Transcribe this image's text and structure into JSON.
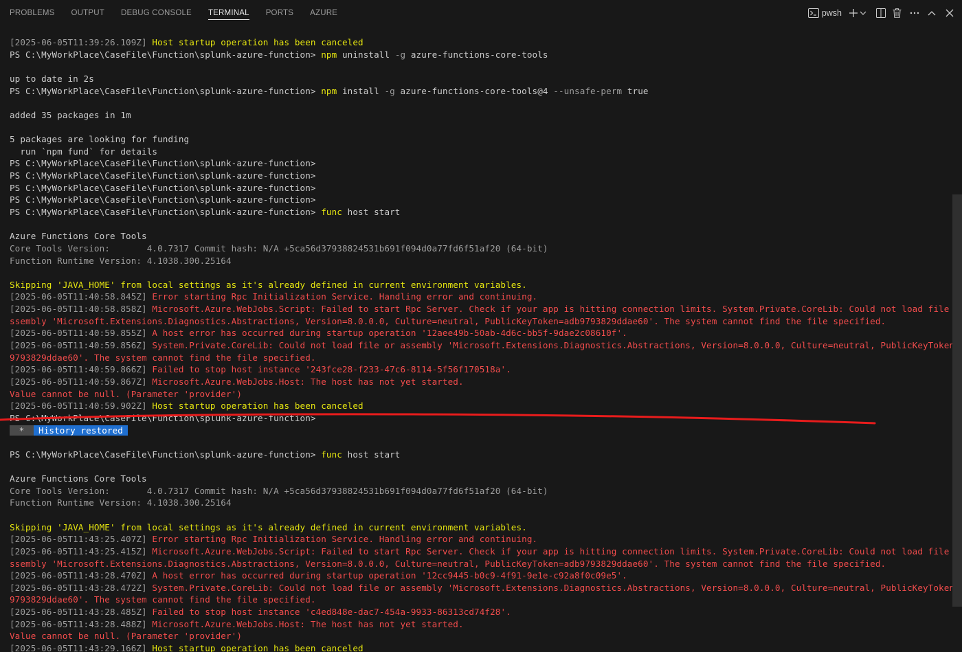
{
  "panel": {
    "tabs": [
      "PROBLEMS",
      "OUTPUT",
      "DEBUG CONSOLE",
      "TERMINAL",
      "PORTS",
      "AZURE"
    ],
    "active_tab": "TERMINAL",
    "shell": "pwsh"
  },
  "colors": {
    "background": "#181818",
    "timestamp": "#9d9d9d",
    "warning": "#e5e510",
    "error": "#f14c4c",
    "badge": "#1f6fd0",
    "annotation": "#e81c1c"
  },
  "terminal": {
    "lines": [
      [
        {
          "c": "ts",
          "t": "[2025-06-05T11:39:26.109Z] "
        },
        {
          "c": "yl",
          "t": "Host startup operation has been canceled"
        }
      ],
      [
        {
          "c": "",
          "t": "PS C:\\MyWorkPlace\\CaseFile\\Function\\splunk-azure-function> "
        },
        {
          "c": "cmd",
          "t": "npm"
        },
        {
          "c": "arg",
          "t": " uninstall "
        },
        {
          "c": "flag",
          "t": "-g"
        },
        {
          "c": "arg",
          "t": " azure-functions-core-tools"
        }
      ],
      [],
      [
        {
          "c": "",
          "t": "up to date in 2s"
        }
      ],
      [
        {
          "c": "",
          "t": "PS C:\\MyWorkPlace\\CaseFile\\Function\\splunk-azure-function> "
        },
        {
          "c": "cmd",
          "t": "npm"
        },
        {
          "c": "arg",
          "t": " install "
        },
        {
          "c": "flag",
          "t": "-g"
        },
        {
          "c": "arg",
          "t": " azure-functions-core-tools@4 "
        },
        {
          "c": "flag",
          "t": "--unsafe-perm"
        },
        {
          "c": "arg",
          "t": " true"
        }
      ],
      [],
      [
        {
          "c": "",
          "t": "added 35 packages in 1m"
        }
      ],
      [],
      [
        {
          "c": "",
          "t": "5 packages are looking for funding"
        }
      ],
      [
        {
          "c": "",
          "t": "  run `npm fund` for details"
        }
      ],
      [
        {
          "c": "",
          "t": "PS C:\\MyWorkPlace\\CaseFile\\Function\\splunk-azure-function>"
        }
      ],
      [
        {
          "c": "",
          "t": "PS C:\\MyWorkPlace\\CaseFile\\Function\\splunk-azure-function>"
        }
      ],
      [
        {
          "c": "",
          "t": "PS C:\\MyWorkPlace\\CaseFile\\Function\\splunk-azure-function>"
        }
      ],
      [
        {
          "c": "",
          "t": "PS C:\\MyWorkPlace\\CaseFile\\Function\\splunk-azure-function>"
        }
      ],
      [
        {
          "c": "",
          "t": "PS C:\\MyWorkPlace\\CaseFile\\Function\\splunk-azure-function> "
        },
        {
          "c": "cmd",
          "t": "func"
        },
        {
          "c": "arg",
          "t": " host start"
        }
      ],
      [],
      [
        {
          "c": "",
          "t": "Azure Functions Core Tools"
        }
      ],
      [
        {
          "c": "gray",
          "t": "Core Tools Version:       4.0.7317 Commit hash: N/A +5ca56d37938824531b691f094d0a77fd6f51af20 (64-bit)"
        }
      ],
      [
        {
          "c": "gray",
          "t": "Function Runtime Version: 4.1038.300.25164"
        }
      ],
      [],
      [
        {
          "c": "yl",
          "t": "Skipping 'JAVA_HOME' from local settings as it's already defined in current environment variables."
        }
      ],
      [
        {
          "c": "ts",
          "t": "[2025-06-05T11:40:58.845Z] "
        },
        {
          "c": "rd",
          "t": "Error starting Rpc Initialization Service. Handling error and continuing."
        }
      ],
      [
        {
          "c": "ts",
          "t": "[2025-06-05T11:40:58.858Z] "
        },
        {
          "c": "rd",
          "t": "Microsoft.Azure.WebJobs.Script: Failed to start Rpc Server. Check if your app is hitting connection limits. System.Private.CoreLib: Could not load file or a"
        }
      ],
      [
        {
          "c": "rd",
          "t": "ssembly 'Microsoft.Extensions.Diagnostics.Abstractions, Version=8.0.0.0, Culture=neutral, PublicKeyToken=adb9793829ddae60'. The system cannot find the file specified."
        }
      ],
      [
        {
          "c": "ts",
          "t": "[2025-06-05T11:40:59.855Z] "
        },
        {
          "c": "rd",
          "t": "A host error has occurred during startup operation '12aee49b-50ab-4d6c-bb5f-9dae2c08610f'."
        }
      ],
      [
        {
          "c": "ts",
          "t": "[2025-06-05T11:40:59.856Z] "
        },
        {
          "c": "rd",
          "t": "System.Private.CoreLib: Could not load file or assembly 'Microsoft.Extensions.Diagnostics.Abstractions, Version=8.0.0.0, Culture=neutral, PublicKeyToken=adb"
        }
      ],
      [
        {
          "c": "rd",
          "t": "9793829ddae60'. The system cannot find the file specified."
        }
      ],
      [
        {
          "c": "ts",
          "t": "[2025-06-05T11:40:59.866Z] "
        },
        {
          "c": "rd",
          "t": "Failed to stop host instance '243fce28-f233-47c6-8114-5f56f170518a'."
        }
      ],
      [
        {
          "c": "ts",
          "t": "[2025-06-05T11:40:59.867Z] "
        },
        {
          "c": "rd",
          "t": "Microsoft.Azure.WebJobs.Host: The host has not yet started."
        }
      ],
      [
        {
          "c": "rd",
          "t": "Value cannot be null. (Parameter 'provider')"
        }
      ],
      [
        {
          "c": "ts",
          "t": "[2025-06-05T11:40:59.902Z] "
        },
        {
          "c": "yl",
          "t": "Host startup operation has been canceled"
        }
      ],
      [
        {
          "c": "",
          "t": "PS C:\\MyWorkPlace\\CaseFile\\Function\\splunk-azure-function>"
        }
      ],
      [
        {
          "c": "badge-star",
          "t": " * "
        },
        {
          "c": "badge",
          "t": "History restored"
        }
      ],
      [],
      [
        {
          "c": "",
          "t": "PS C:\\MyWorkPlace\\CaseFile\\Function\\splunk-azure-function> "
        },
        {
          "c": "cmd",
          "t": "func"
        },
        {
          "c": "arg",
          "t": " host start"
        }
      ],
      [],
      [
        {
          "c": "",
          "t": "Azure Functions Core Tools"
        }
      ],
      [
        {
          "c": "gray",
          "t": "Core Tools Version:       4.0.7317 Commit hash: N/A +5ca56d37938824531b691f094d0a77fd6f51af20 (64-bit)"
        }
      ],
      [
        {
          "c": "gray",
          "t": "Function Runtime Version: 4.1038.300.25164"
        }
      ],
      [],
      [
        {
          "c": "yl",
          "t": "Skipping 'JAVA_HOME' from local settings as it's already defined in current environment variables."
        }
      ],
      [
        {
          "c": "ts",
          "t": "[2025-06-05T11:43:25.407Z] "
        },
        {
          "c": "rd",
          "t": "Error starting Rpc Initialization Service. Handling error and continuing."
        }
      ],
      [
        {
          "c": "ts",
          "t": "[2025-06-05T11:43:25.415Z] "
        },
        {
          "c": "rd",
          "t": "Microsoft.Azure.WebJobs.Script: Failed to start Rpc Server. Check if your app is hitting connection limits. System.Private.CoreLib: Could not load file or a"
        }
      ],
      [
        {
          "c": "rd",
          "t": "ssembly 'Microsoft.Extensions.Diagnostics.Abstractions, Version=8.0.0.0, Culture=neutral, PublicKeyToken=adb9793829ddae60'. The system cannot find the file specified."
        }
      ],
      [
        {
          "c": "ts",
          "t": "[2025-06-05T11:43:28.470Z] "
        },
        {
          "c": "rd",
          "t": "A host error has occurred during startup operation '12cc9445-b0c9-4f91-9e1e-c92a8f0c09e5'."
        }
      ],
      [
        {
          "c": "ts",
          "t": "[2025-06-05T11:43:28.472Z] "
        },
        {
          "c": "rd",
          "t": "System.Private.CoreLib: Could not load file or assembly 'Microsoft.Extensions.Diagnostics.Abstractions, Version=8.0.0.0, Culture=neutral, PublicKeyToken=adb"
        }
      ],
      [
        {
          "c": "rd",
          "t": "9793829ddae60'. The system cannot find the file specified."
        }
      ],
      [
        {
          "c": "ts",
          "t": "[2025-06-05T11:43:28.485Z] "
        },
        {
          "c": "rd",
          "t": "Failed to stop host instance 'c4ed848e-dac7-454a-9933-86313cd74f28'."
        }
      ],
      [
        {
          "c": "ts",
          "t": "[2025-06-05T11:43:28.488Z] "
        },
        {
          "c": "rd",
          "t": "Microsoft.Azure.WebJobs.Host: The host has not yet started."
        }
      ],
      [
        {
          "c": "rd",
          "t": "Value cannot be null. (Parameter 'provider')"
        }
      ],
      [
        {
          "c": "ts",
          "t": "[2025-06-05T11:43:29.166Z] "
        },
        {
          "c": "yl",
          "t": "Host startup operation has been canceled"
        }
      ]
    ]
  }
}
